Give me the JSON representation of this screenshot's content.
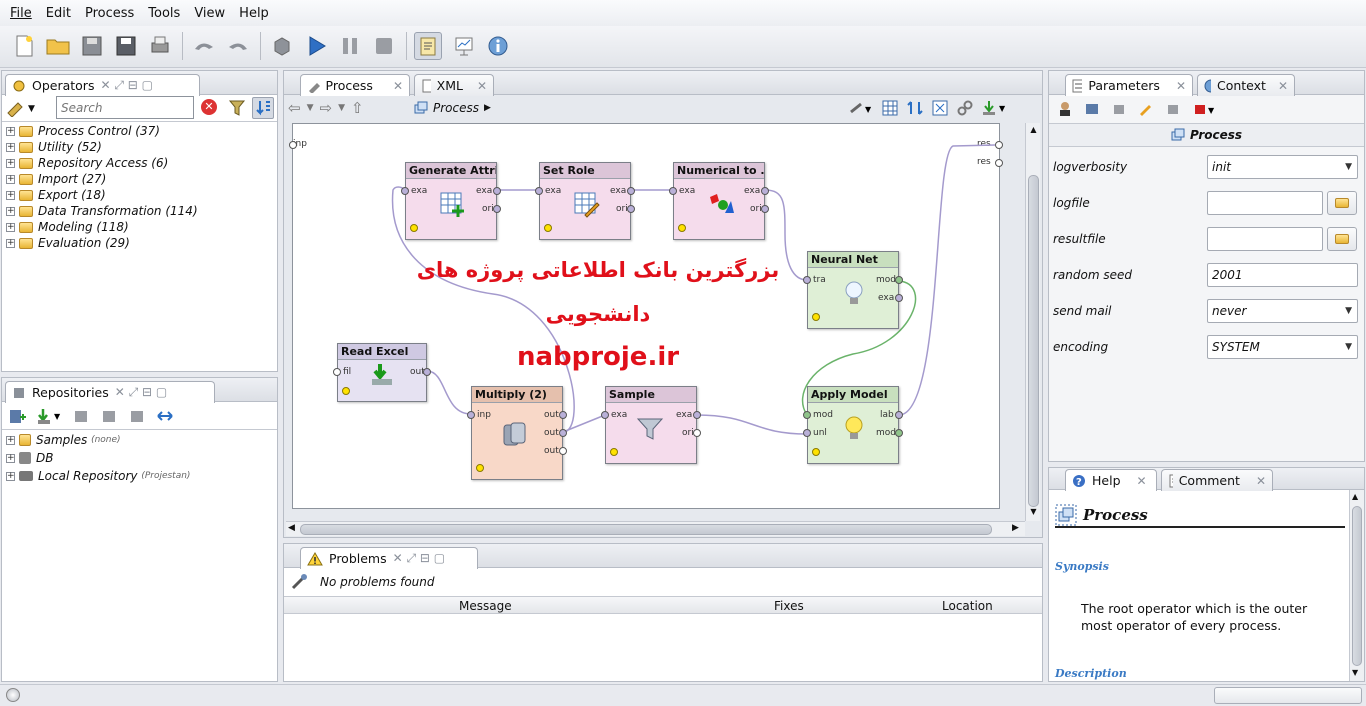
{
  "menu": [
    "File",
    "Edit",
    "Process",
    "Tools",
    "View",
    "Help"
  ],
  "operators": {
    "tab": "Operators",
    "search_placeholder": "Search",
    "items": [
      {
        "label": "Process Control (37)"
      },
      {
        "label": "Utility (52)"
      },
      {
        "label": "Repository Access (6)"
      },
      {
        "label": "Import (27)"
      },
      {
        "label": "Export (18)"
      },
      {
        "label": "Data Transformation (114)"
      },
      {
        "label": "Modeling (118)"
      },
      {
        "label": "Evaluation (29)"
      }
    ]
  },
  "repositories": {
    "tab": "Repositories",
    "items": [
      {
        "label": "Samples",
        "note": "(none)"
      },
      {
        "label": "DB",
        "note": ""
      },
      {
        "label": "Local Repository",
        "note": "(Projestan)"
      }
    ]
  },
  "editor": {
    "tabs": [
      "Process",
      "XML"
    ],
    "breadcrumb": "Process",
    "input_port": "inp",
    "output_ports": [
      "res",
      "res"
    ],
    "operators": {
      "generate": {
        "title": "Generate Attri...",
        "ports_in": [
          "exa"
        ],
        "ports_out": [
          "exa",
          "ori"
        ]
      },
      "setrole": {
        "title": "Set Role",
        "ports_in": [
          "exa"
        ],
        "ports_out": [
          "exa",
          "ori"
        ]
      },
      "numerical": {
        "title": "Numerical to ...",
        "ports_in": [
          "exa"
        ],
        "ports_out": [
          "exa",
          "ori"
        ]
      },
      "neural": {
        "title": "Neural Net",
        "ports_in": [
          "tra"
        ],
        "ports_out": [
          "mod",
          "exa"
        ]
      },
      "readexcel": {
        "title": "Read Excel",
        "ports_in": [
          "fil"
        ],
        "ports_out": [
          "out"
        ]
      },
      "multiply": {
        "title": "Multiply (2)",
        "ports_in": [
          "inp"
        ],
        "ports_out": [
          "out",
          "out",
          "out"
        ]
      },
      "sample": {
        "title": "Sample",
        "ports_in": [
          "exa"
        ],
        "ports_out": [
          "exa",
          "ori"
        ]
      },
      "apply": {
        "title": "Apply Model",
        "ports_in": [
          "mod",
          "unl"
        ],
        "ports_out": [
          "lab",
          "mod"
        ]
      }
    },
    "watermark": {
      "line1": "بزرگترین بانک اطلاعاتی پروژه های",
      "line2": "دانشجویی",
      "line3": "nabproje.ir"
    }
  },
  "problems": {
    "tab": "Problems",
    "status": "No problems found",
    "columns": [
      "Message",
      "Fixes",
      "Location"
    ]
  },
  "parameters": {
    "tabs": [
      "Parameters",
      "Context"
    ],
    "title": "Process",
    "rows": [
      {
        "label": "logverbosity",
        "value": "init",
        "kind": "combo"
      },
      {
        "label": "logfile",
        "value": "",
        "kind": "file"
      },
      {
        "label": "resultfile",
        "value": "",
        "kind": "file"
      },
      {
        "label": "random seed",
        "value": "2001",
        "kind": "text"
      },
      {
        "label": "send mail",
        "value": "never",
        "kind": "combo"
      },
      {
        "label": "encoding",
        "value": "SYSTEM",
        "kind": "combo"
      }
    ]
  },
  "help": {
    "tabs": [
      "Help",
      "Comment"
    ],
    "title": "Process",
    "synopsis_heading": "Synopsis",
    "synopsis": "The root operator which is the outer most operator of every process.",
    "description_heading": "Description"
  },
  "colors": {
    "blue_op": "#f5dcec",
    "multiply": "#f8d8c8",
    "readexcel": "#e6e2f2",
    "green_op": "#dfefd6",
    "watermark_red": "#e0101a"
  }
}
